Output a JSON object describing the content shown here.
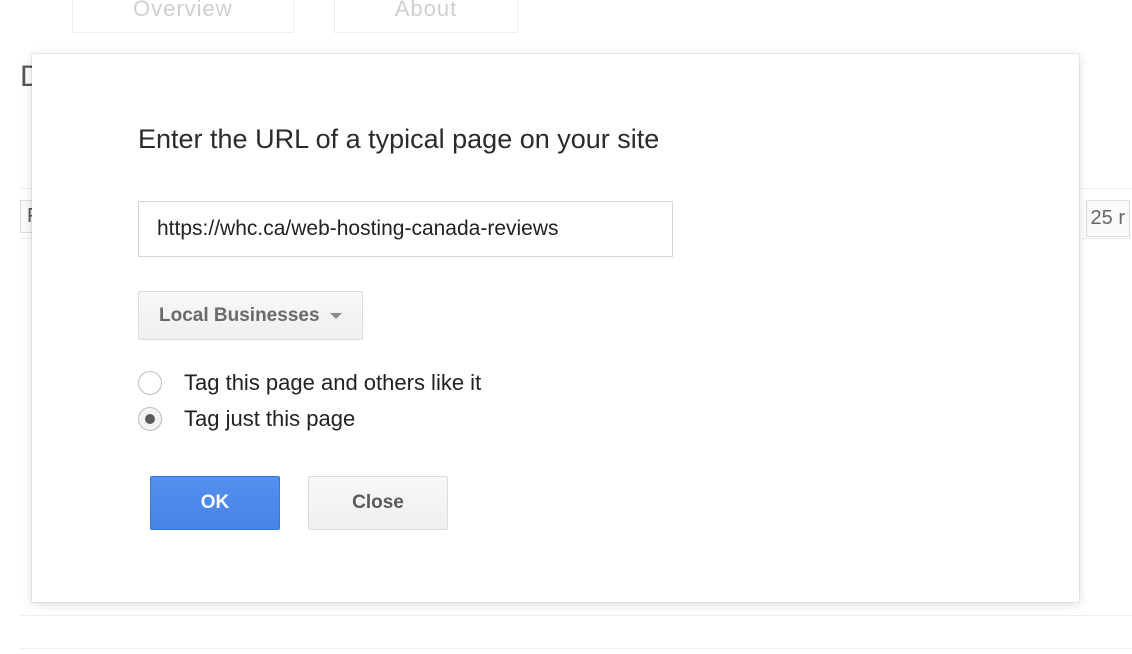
{
  "background": {
    "tab1": "Overview",
    "tab2": "About",
    "letterD": "D",
    "letterF": "F",
    "text25": "25 r"
  },
  "modal": {
    "title": "Enter the URL of a typical page on your site",
    "url_value": "https://whc.ca/web-hosting-canada-reviews",
    "url_placeholder": "",
    "dropdown_label": "Local Businesses",
    "radio": {
      "option1": "Tag this page and others like it",
      "option2": "Tag just this page",
      "selected": "option2"
    },
    "ok_label": "OK",
    "close_label": "Close"
  }
}
